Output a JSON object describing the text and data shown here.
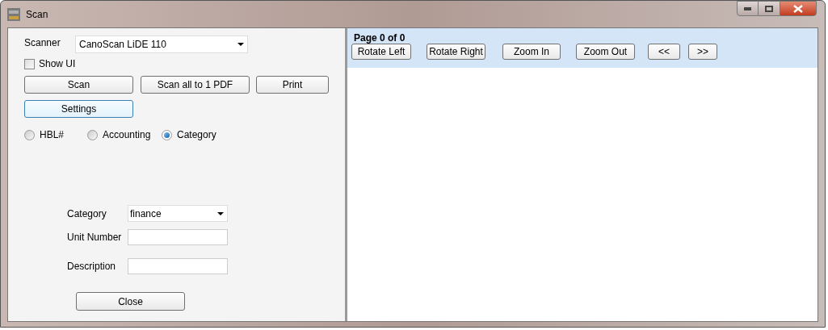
{
  "window": {
    "title": "Scan"
  },
  "scanner": {
    "label": "Scanner",
    "value": "CanoScan LiDE 110"
  },
  "show_ui": {
    "label": "Show UI",
    "checked": false
  },
  "actions": [
    "Scan",
    "Scan all to 1 PDF",
    "Print"
  ],
  "settings_button": "Settings",
  "modes": [
    {
      "label": "HBL#",
      "selected": false
    },
    {
      "label": "Accounting",
      "selected": false
    },
    {
      "label": "Category",
      "selected": true
    }
  ],
  "form": [
    {
      "kind": "dropdown",
      "label": "Category",
      "value": "finance"
    },
    {
      "kind": "text",
      "label": "Unit Number"
    },
    {
      "kind": "text",
      "label": "Description"
    }
  ],
  "close_button": "Close",
  "viewer": {
    "page_label": "Page 0 of 0",
    "toolbar": [
      "Rotate Left",
      "Rotate Right",
      "Zoom In",
      "Zoom Out",
      "<<",
      ">>"
    ]
  }
}
